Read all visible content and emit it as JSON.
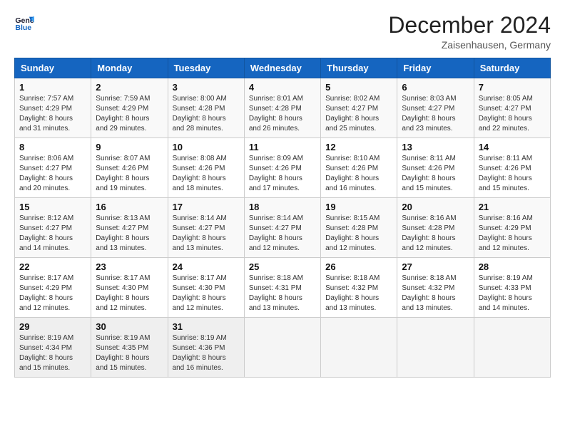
{
  "header": {
    "logo_line1": "General",
    "logo_line2": "Blue",
    "title": "December 2024",
    "subtitle": "Zaisenhausen, Germany"
  },
  "days_of_week": [
    "Sunday",
    "Monday",
    "Tuesday",
    "Wednesday",
    "Thursday",
    "Friday",
    "Saturday"
  ],
  "weeks": [
    [
      {
        "day": "1",
        "info": "Sunrise: 7:57 AM\nSunset: 4:29 PM\nDaylight: 8 hours\nand 31 minutes."
      },
      {
        "day": "2",
        "info": "Sunrise: 7:59 AM\nSunset: 4:29 PM\nDaylight: 8 hours\nand 29 minutes."
      },
      {
        "day": "3",
        "info": "Sunrise: 8:00 AM\nSunset: 4:28 PM\nDaylight: 8 hours\nand 28 minutes."
      },
      {
        "day": "4",
        "info": "Sunrise: 8:01 AM\nSunset: 4:28 PM\nDaylight: 8 hours\nand 26 minutes."
      },
      {
        "day": "5",
        "info": "Sunrise: 8:02 AM\nSunset: 4:27 PM\nDaylight: 8 hours\nand 25 minutes."
      },
      {
        "day": "6",
        "info": "Sunrise: 8:03 AM\nSunset: 4:27 PM\nDaylight: 8 hours\nand 23 minutes."
      },
      {
        "day": "7",
        "info": "Sunrise: 8:05 AM\nSunset: 4:27 PM\nDaylight: 8 hours\nand 22 minutes."
      }
    ],
    [
      {
        "day": "8",
        "info": "Sunrise: 8:06 AM\nSunset: 4:27 PM\nDaylight: 8 hours\nand 20 minutes."
      },
      {
        "day": "9",
        "info": "Sunrise: 8:07 AM\nSunset: 4:26 PM\nDaylight: 8 hours\nand 19 minutes."
      },
      {
        "day": "10",
        "info": "Sunrise: 8:08 AM\nSunset: 4:26 PM\nDaylight: 8 hours\nand 18 minutes."
      },
      {
        "day": "11",
        "info": "Sunrise: 8:09 AM\nSunset: 4:26 PM\nDaylight: 8 hours\nand 17 minutes."
      },
      {
        "day": "12",
        "info": "Sunrise: 8:10 AM\nSunset: 4:26 PM\nDaylight: 8 hours\nand 16 minutes."
      },
      {
        "day": "13",
        "info": "Sunrise: 8:11 AM\nSunset: 4:26 PM\nDaylight: 8 hours\nand 15 minutes."
      },
      {
        "day": "14",
        "info": "Sunrise: 8:11 AM\nSunset: 4:26 PM\nDaylight: 8 hours\nand 15 minutes."
      }
    ],
    [
      {
        "day": "15",
        "info": "Sunrise: 8:12 AM\nSunset: 4:27 PM\nDaylight: 8 hours\nand 14 minutes."
      },
      {
        "day": "16",
        "info": "Sunrise: 8:13 AM\nSunset: 4:27 PM\nDaylight: 8 hours\nand 13 minutes."
      },
      {
        "day": "17",
        "info": "Sunrise: 8:14 AM\nSunset: 4:27 PM\nDaylight: 8 hours\nand 13 minutes."
      },
      {
        "day": "18",
        "info": "Sunrise: 8:14 AM\nSunset: 4:27 PM\nDaylight: 8 hours\nand 12 minutes."
      },
      {
        "day": "19",
        "info": "Sunrise: 8:15 AM\nSunset: 4:28 PM\nDaylight: 8 hours\nand 12 minutes."
      },
      {
        "day": "20",
        "info": "Sunrise: 8:16 AM\nSunset: 4:28 PM\nDaylight: 8 hours\nand 12 minutes."
      },
      {
        "day": "21",
        "info": "Sunrise: 8:16 AM\nSunset: 4:29 PM\nDaylight: 8 hours\nand 12 minutes."
      }
    ],
    [
      {
        "day": "22",
        "info": "Sunrise: 8:17 AM\nSunset: 4:29 PM\nDaylight: 8 hours\nand 12 minutes."
      },
      {
        "day": "23",
        "info": "Sunrise: 8:17 AM\nSunset: 4:30 PM\nDaylight: 8 hours\nand 12 minutes."
      },
      {
        "day": "24",
        "info": "Sunrise: 8:17 AM\nSunset: 4:30 PM\nDaylight: 8 hours\nand 12 minutes."
      },
      {
        "day": "25",
        "info": "Sunrise: 8:18 AM\nSunset: 4:31 PM\nDaylight: 8 hours\nand 13 minutes."
      },
      {
        "day": "26",
        "info": "Sunrise: 8:18 AM\nSunset: 4:32 PM\nDaylight: 8 hours\nand 13 minutes."
      },
      {
        "day": "27",
        "info": "Sunrise: 8:18 AM\nSunset: 4:32 PM\nDaylight: 8 hours\nand 13 minutes."
      },
      {
        "day": "28",
        "info": "Sunrise: 8:19 AM\nSunset: 4:33 PM\nDaylight: 8 hours\nand 14 minutes."
      }
    ],
    [
      {
        "day": "29",
        "info": "Sunrise: 8:19 AM\nSunset: 4:34 PM\nDaylight: 8 hours\nand 15 minutes."
      },
      {
        "day": "30",
        "info": "Sunrise: 8:19 AM\nSunset: 4:35 PM\nDaylight: 8 hours\nand 15 minutes."
      },
      {
        "day": "31",
        "info": "Sunrise: 8:19 AM\nSunset: 4:36 PM\nDaylight: 8 hours\nand 16 minutes."
      },
      {
        "day": "",
        "info": ""
      },
      {
        "day": "",
        "info": ""
      },
      {
        "day": "",
        "info": ""
      },
      {
        "day": "",
        "info": ""
      }
    ]
  ]
}
